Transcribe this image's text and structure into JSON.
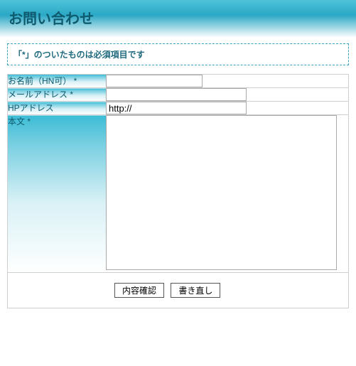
{
  "header": {
    "title": "お問い合わせ"
  },
  "notice": "「*」のついたものは必須項目です",
  "fields": {
    "name": {
      "label": "お名前（HN可） *",
      "value": ""
    },
    "email": {
      "label": "メールアドレス *",
      "value": ""
    },
    "url": {
      "label": "HPアドレス",
      "value": "http://"
    },
    "body": {
      "label": "本文 *",
      "value": ""
    }
  },
  "actions": {
    "confirm": "内容確認",
    "reset": "書き直し"
  }
}
